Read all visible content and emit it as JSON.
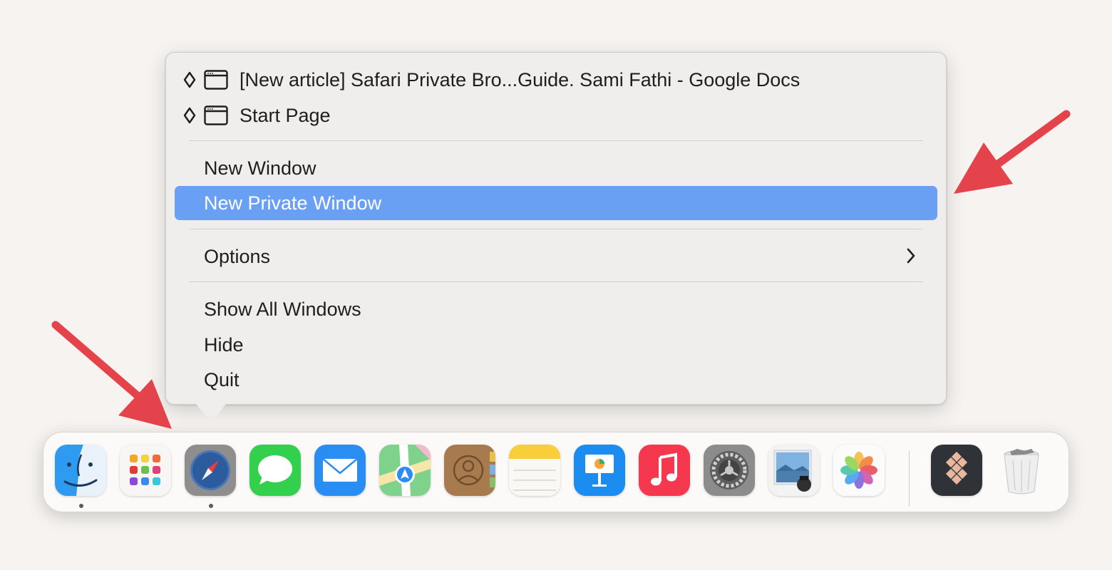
{
  "menu": {
    "window_items": [
      {
        "label": "[New article] Safari Private Bro...Guide. Sami Fathi - Google Docs",
        "icon": "window-icon",
        "marker": "diamond-icon"
      },
      {
        "label": "Start Page",
        "icon": "window-icon",
        "marker": "diamond-icon"
      }
    ],
    "new_window": "New Window",
    "new_private_window": "New Private Window",
    "options": "Options",
    "show_all_windows": "Show All Windows",
    "hide": "Hide",
    "quit": "Quit",
    "highlight_color": "#6aa0f4"
  },
  "dock": {
    "apps": [
      {
        "name": "Finder",
        "icon": "finder-icon",
        "running": true
      },
      {
        "name": "Launchpad",
        "icon": "launchpad-icon",
        "running": false
      },
      {
        "name": "Safari",
        "icon": "safari-icon",
        "running": true
      },
      {
        "name": "Messages",
        "icon": "messages-icon",
        "running": false
      },
      {
        "name": "Mail",
        "icon": "mail-icon",
        "running": false
      },
      {
        "name": "Maps",
        "icon": "maps-icon",
        "running": false
      },
      {
        "name": "Contacts",
        "icon": "contacts-icon",
        "running": false
      },
      {
        "name": "Notes",
        "icon": "notes-icon",
        "running": false
      },
      {
        "name": "Keynote",
        "icon": "keynote-icon",
        "running": false
      },
      {
        "name": "Music",
        "icon": "music-icon",
        "running": false
      },
      {
        "name": "System Settings",
        "icon": "system-settings-icon",
        "running": false
      },
      {
        "name": "Preview",
        "icon": "preview-icon",
        "running": false
      },
      {
        "name": "Photos",
        "icon": "photos-icon",
        "running": false
      },
      {
        "name": "Setapp",
        "icon": "setapp-icon",
        "running": false
      },
      {
        "name": "Trash",
        "icon": "trash-icon",
        "running": false
      }
    ]
  },
  "annotations": {
    "arrow_color": "#e5434b"
  }
}
